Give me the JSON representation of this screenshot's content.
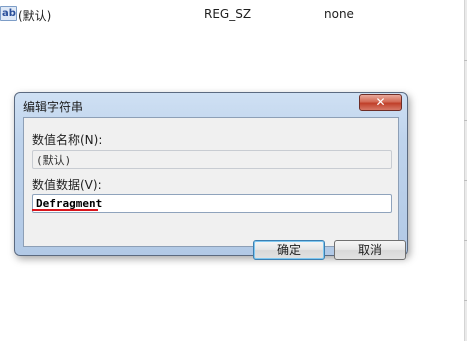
{
  "registry_row": {
    "icon_text": "ab",
    "name": "(默认)",
    "type": "REG_SZ",
    "data": "none"
  },
  "dialog": {
    "title": "编辑字符串",
    "close_symbol": "✕",
    "value_name_label": "数值名称(N):",
    "value_name": "(默认)",
    "value_data_label": "数值数据(V):",
    "value_data": "Defragment",
    "ok_label": "确定",
    "cancel_label": "取消"
  },
  "colors": {
    "annotation_underline": "#d9141c",
    "title_bar": "#bed3ec",
    "close_button": "#c0402a"
  }
}
